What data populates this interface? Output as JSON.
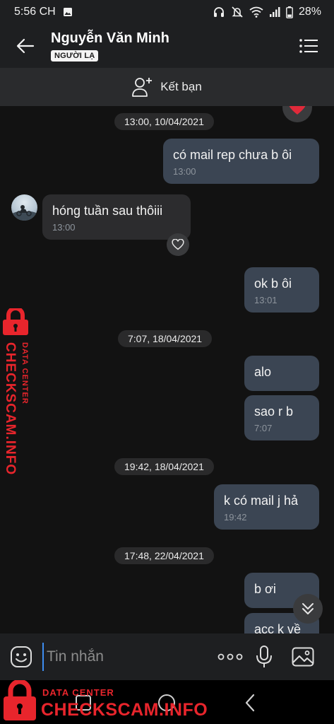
{
  "status_bar": {
    "time": "5:56 CH",
    "battery": "28%"
  },
  "header": {
    "contact_name": "Nguyễn Văn Minh",
    "stranger_badge": "NGƯỜI LẠ"
  },
  "friend_bar": {
    "label": "Kết bạn"
  },
  "messages": [
    {
      "type": "date",
      "label": "13:00, 10/04/2021"
    },
    {
      "type": "sent",
      "text": "có mail rep chưa b ôi",
      "time": "13:00"
    },
    {
      "type": "received",
      "text": "hóng tuần sau thôiii",
      "time": "13:00"
    },
    {
      "type": "sent",
      "text": "ok b ôi",
      "time": "13:01"
    },
    {
      "type": "date",
      "label": "7:07, 18/04/2021"
    },
    {
      "type": "sent",
      "text": "alo",
      "time": ""
    },
    {
      "type": "sent",
      "text": "sao r b",
      "time": "7:07"
    },
    {
      "type": "date",
      "label": "19:42, 18/04/2021"
    },
    {
      "type": "sent",
      "text": "k có mail j hả",
      "time": "19:42"
    },
    {
      "type": "date",
      "label": "17:48, 22/04/2021"
    },
    {
      "type": "sent",
      "text": "b ơi",
      "time": ""
    },
    {
      "type": "sent",
      "text": "acc k về",
      "time": ""
    }
  ],
  "input": {
    "placeholder": "Tin nhắn"
  },
  "watermark": {
    "small": "DATA CENTER",
    "big": "CHECKSCAM.INFO"
  },
  "icons": [
    "headphones-icon",
    "mute-icon",
    "wifi-icon",
    "signal-icon",
    "battery-icon",
    "back-arrow-icon",
    "menu-list-icon",
    "add-friend-icon",
    "heart-icon",
    "heart-outline-icon",
    "chevron-double-down-icon",
    "emoji-icon",
    "more-dots-icon",
    "microphone-icon",
    "image-icon",
    "recent-apps-icon",
    "home-icon",
    "nav-back-icon",
    "lock-icon"
  ],
  "colors": {
    "sent_bubble": "#3b4553",
    "received_bubble": "#2c2c2e",
    "accent": "#3d8cf0",
    "watermark_red": "#e8252c",
    "heart_red": "#e02a3a"
  }
}
